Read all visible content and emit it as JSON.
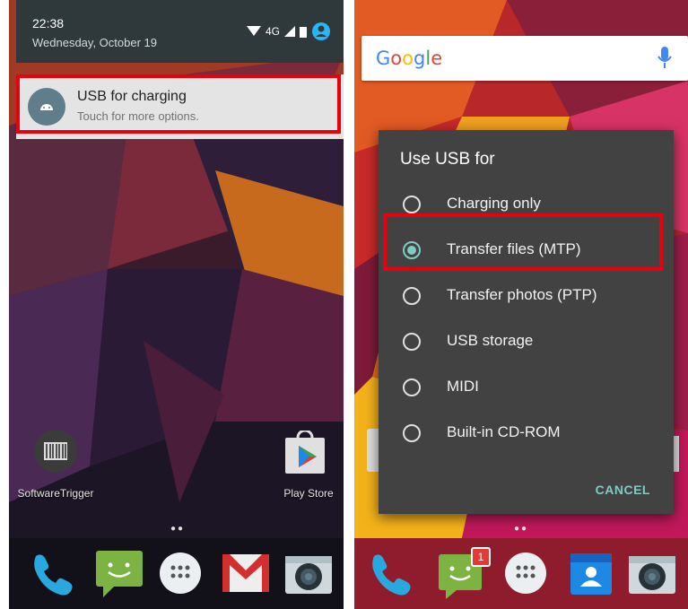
{
  "left_screen": {
    "status": {
      "time": "22:38",
      "date": "Wednesday, October 19",
      "network": "4G"
    },
    "notification": {
      "title": "USB for charging",
      "subtitle": "Touch for more options."
    },
    "apps": {
      "software_trigger": "SoftwareTrigger",
      "play_store": "Play Store"
    },
    "page_indicator": "●●"
  },
  "right_screen": {
    "search": {
      "logo": "Google"
    },
    "dialog": {
      "title": "Use USB for",
      "options": [
        {
          "label": "Charging only",
          "selected": false
        },
        {
          "label": "Transfer files (MTP)",
          "selected": true
        },
        {
          "label": "Transfer photos (PTP)",
          "selected": false
        },
        {
          "label": "USB storage",
          "selected": false
        },
        {
          "label": "MIDI",
          "selected": false
        },
        {
          "label": "Built-in CD-ROM",
          "selected": false
        }
      ],
      "cancel_label": "CANCEL"
    },
    "messages_badge": "1",
    "page_indicator": "●●"
  },
  "colors": {
    "highlight": "#e8000c",
    "accent": "#80cbc4",
    "dialog_bg": "#424242"
  }
}
